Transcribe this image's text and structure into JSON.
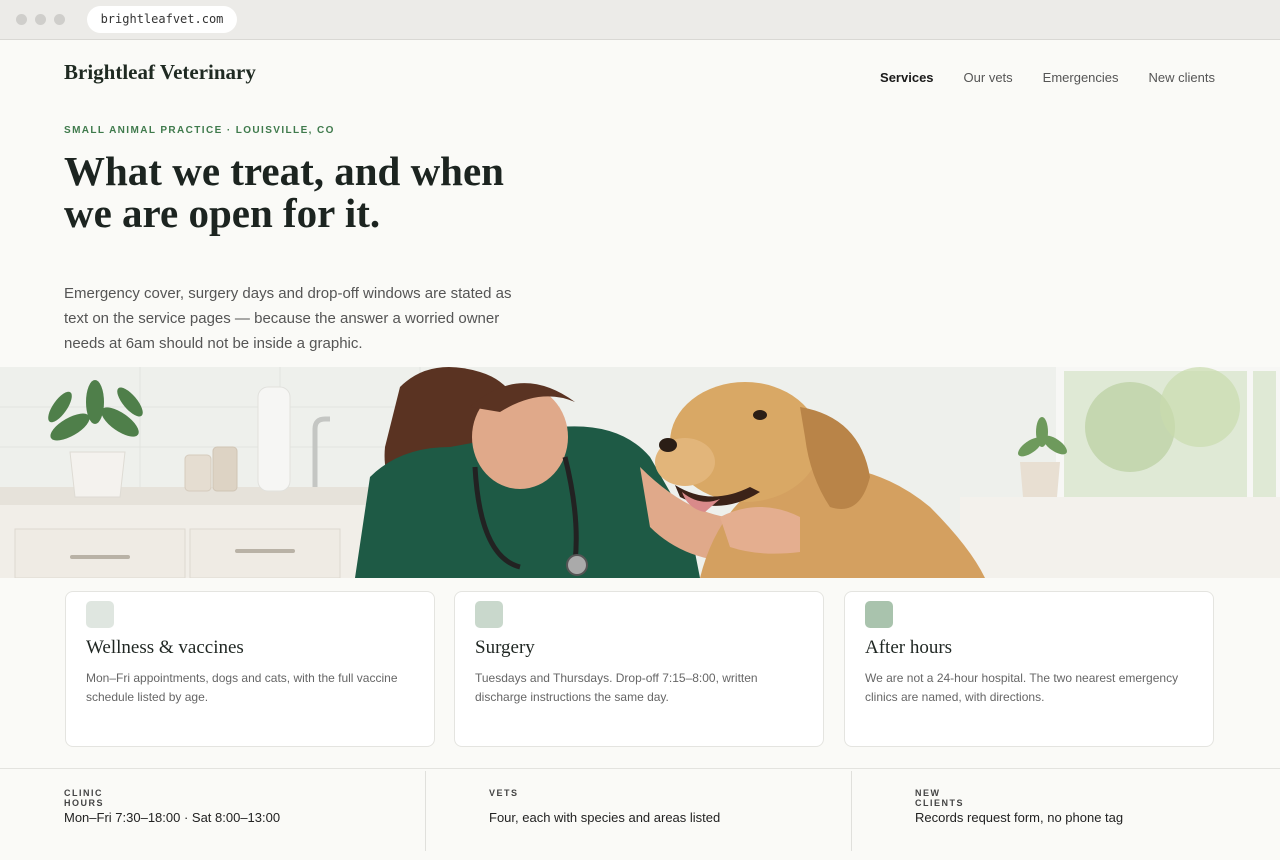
{
  "browser": {
    "url": "brightleafvet.com"
  },
  "header": {
    "brand": "Brightleaf Veterinary",
    "nav": [
      "Services",
      "Our vets",
      "Emergencies",
      "New clients"
    ]
  },
  "hero": {
    "eyebrow": "SMALL ANIMAL PRACTICE · LOUISVILLE, CO",
    "headline": "What we treat, and when we are open for it.",
    "lead": "Emergency cover, surgery days and drop-off windows are stated as text on the service pages — because the answer a worried owner needs at 6am should not be inside a graphic."
  },
  "cards": [
    {
      "title": "Wellness & vaccines",
      "desc": "Mon–Fri appointments, dogs and cats, with the full vaccine schedule listed by age.",
      "swatch": "#dfe6e0"
    },
    {
      "title": "Surgery",
      "desc": "Tuesdays and Thursdays. Drop-off 7:15–8:00, written discharge instructions the same day.",
      "swatch": "#c9d8cc"
    },
    {
      "title": "After hours",
      "desc": "We are not a 24-hour hospital. The two nearest emergency clinics are named, with directions.",
      "swatch": "#a9c3ad"
    }
  ],
  "info": [
    {
      "label": "CLINIC HOURS",
      "value": "Mon–Fri 7:30–18:00 · Sat 8:00–13:00"
    },
    {
      "label": "VETS",
      "value": "Four, each with species and areas listed"
    },
    {
      "label": "NEW CLIENTS",
      "value": "Records request form, no phone tag"
    }
  ],
  "colors": {
    "accent": "#3f7a4c",
    "scrubs": "#1e5a45",
    "dog": "#d4a060"
  }
}
